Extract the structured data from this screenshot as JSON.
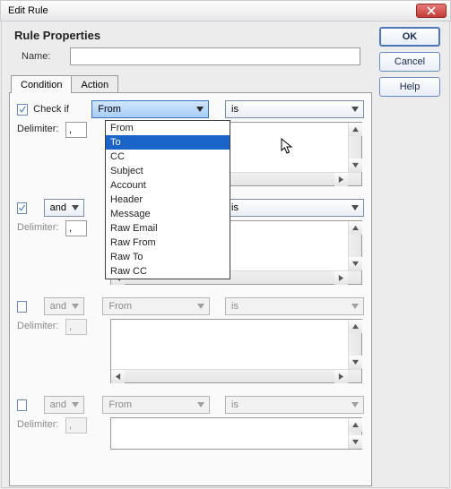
{
  "window": {
    "title": "Edit Rule"
  },
  "buttons": {
    "ok": "OK",
    "cancel": "Cancel",
    "help": "Help"
  },
  "heading": "Rule Properties",
  "name_label": "Name:",
  "name_value": "",
  "tabs": {
    "condition": "Condition",
    "action": "Action"
  },
  "check_if_label": "Check if",
  "and_label": "and",
  "delimiter_label": "Delimiter:",
  "field_selected": "From",
  "match_selected": "is",
  "delimiter_value": ",",
  "field_options": [
    "From",
    "To",
    "CC",
    "Subject",
    "Account",
    "Header",
    "Message",
    "Raw Email",
    "Raw From",
    "Raw To",
    "Raw CC"
  ],
  "dropdown_selected_index": 1,
  "rows": [
    {
      "checked": true,
      "enabled": true,
      "label_mode": "checkif",
      "field": "From",
      "match": "is",
      "delimiter": ","
    },
    {
      "checked": true,
      "enabled": true,
      "label_mode": "and",
      "field": "",
      "match": "is",
      "delimiter": ","
    },
    {
      "checked": false,
      "enabled": false,
      "label_mode": "and",
      "field": "From",
      "match": "is",
      "delimiter": ","
    },
    {
      "checked": false,
      "enabled": false,
      "label_mode": "and",
      "field": "From",
      "match": "is",
      "delimiter": ","
    }
  ]
}
